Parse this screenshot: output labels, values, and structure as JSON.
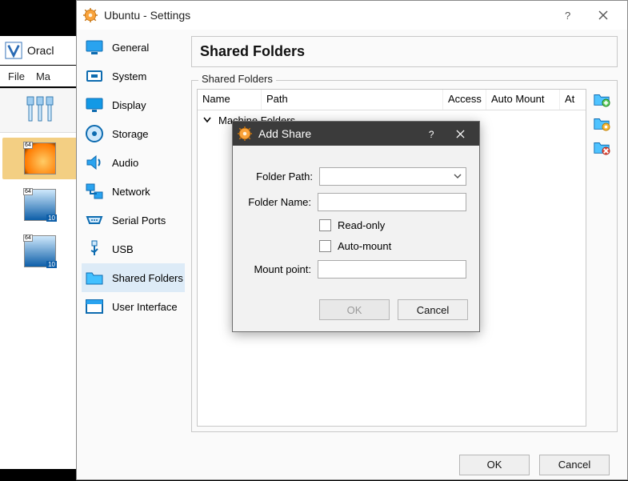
{
  "vbox": {
    "title": "Oracl",
    "menu": {
      "file": "File",
      "machine": "Ma"
    }
  },
  "settings": {
    "title": "Ubuntu - Settings",
    "sidebar": {
      "items": [
        {
          "label": "General"
        },
        {
          "label": "System"
        },
        {
          "label": "Display"
        },
        {
          "label": "Storage"
        },
        {
          "label": "Audio"
        },
        {
          "label": "Network"
        },
        {
          "label": "Serial Ports"
        },
        {
          "label": "USB"
        },
        {
          "label": "Shared Folders"
        },
        {
          "label": "User Interface"
        }
      ]
    },
    "heading": "Shared Folders",
    "group_label": "Shared Folders",
    "table": {
      "cols": {
        "name": "Name",
        "path": "Path",
        "access": "Access",
        "automount": "Auto Mount",
        "at": "At"
      },
      "root_row": "Machine Folders"
    },
    "buttons": {
      "ok": "OK",
      "cancel": "Cancel"
    }
  },
  "addshare": {
    "title": "Add Share",
    "folder_path_label": "Folder Path:",
    "folder_name_label": "Folder Name:",
    "readonly_label": "Read-only",
    "automount_label": "Auto-mount",
    "mountpoint_label": "Mount point:",
    "folder_path_value": "",
    "folder_name_value": "",
    "mountpoint_value": "",
    "ok": "OK",
    "cancel": "Cancel"
  }
}
